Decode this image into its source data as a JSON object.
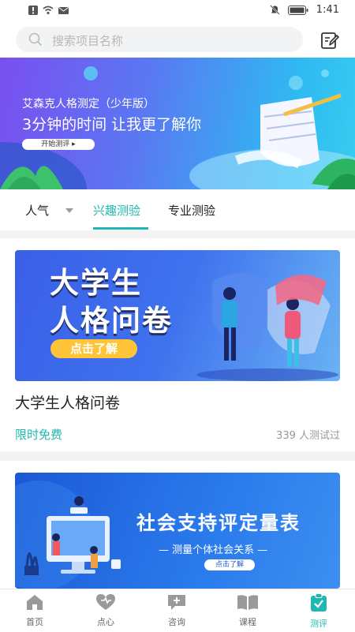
{
  "status": {
    "time": "1:41"
  },
  "search": {
    "placeholder": "搜索项目名称"
  },
  "banner": {
    "subtitle": "艾森克人格测定（少年版）",
    "title": "3分钟的时间 让我更了解你",
    "button": "开始测评 ▸"
  },
  "tabs": [
    {
      "label": "人气"
    },
    {
      "label": "兴趣测验"
    },
    {
      "label": "专业测验"
    }
  ],
  "cards": [
    {
      "thumb_title_line1": "大学生",
      "thumb_title_line2": "人格问卷",
      "thumb_button": "点击了解",
      "title": "大学生人格问卷",
      "price": "限时免费",
      "count": "339 人测试过"
    },
    {
      "thumb_title": "社会支持评定量表",
      "thumb_sub": "— 测量个体社会关系 —",
      "thumb_button": "点击了解"
    }
  ],
  "nav": [
    {
      "label": "首页",
      "icon": "home-icon"
    },
    {
      "label": "点心",
      "icon": "heart-icon"
    },
    {
      "label": "咨询",
      "icon": "chat-plus-icon"
    },
    {
      "label": "课程",
      "icon": "book-icon"
    },
    {
      "label": "测评",
      "icon": "clipboard-check-icon"
    }
  ],
  "colors": {
    "accent": "#1fb8b0"
  }
}
